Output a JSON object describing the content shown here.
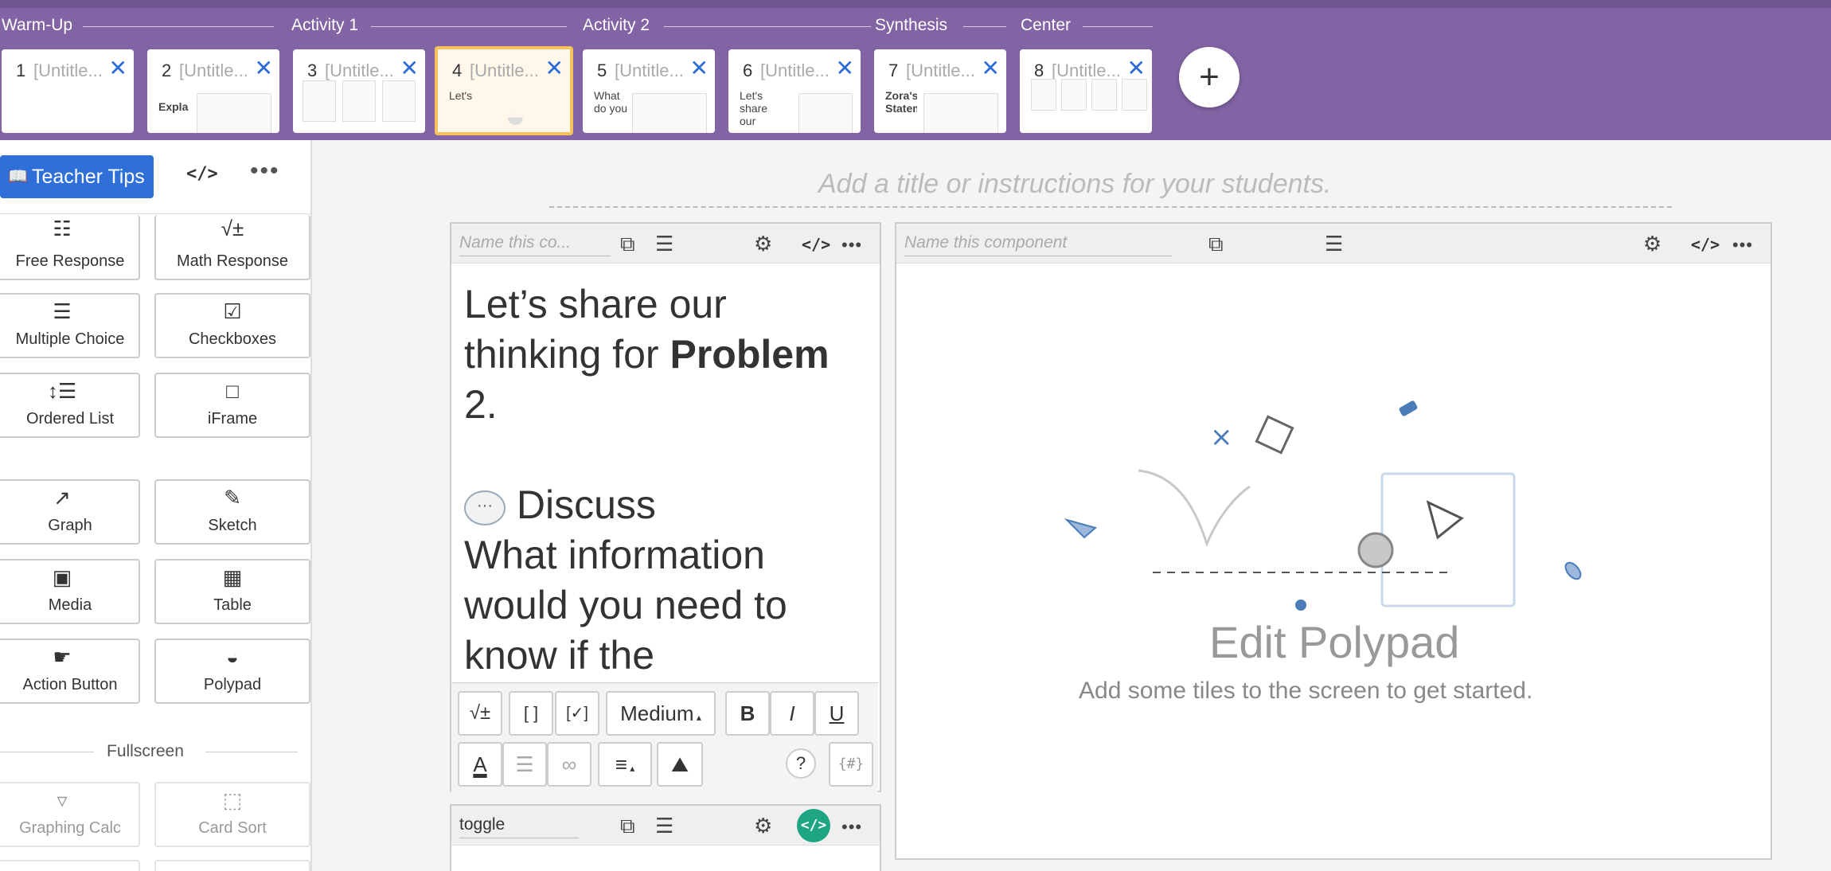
{
  "sections": [
    {
      "label": "Warm-Up"
    },
    {
      "label": "Activity 1"
    },
    {
      "label": "Activity 2"
    },
    {
      "label": "Synthesis"
    },
    {
      "label": "Center"
    }
  ],
  "screens": [
    {
      "num": "1",
      "title": "[Untitle...",
      "snippet": ""
    },
    {
      "num": "2",
      "title": "[Untitle...",
      "snippet": "Expla"
    },
    {
      "num": "3",
      "title": "[Untitle...",
      "snippet": ""
    },
    {
      "num": "4",
      "title": "[Untitle...",
      "snippet": "Let's"
    },
    {
      "num": "5",
      "title": "[Untitle...",
      "snippet": "What do you"
    },
    {
      "num": "6",
      "title": "[Untitle...",
      "snippet": "Let's share our"
    },
    {
      "num": "7",
      "title": "[Untitle...",
      "snippet": "Zora's Statement"
    },
    {
      "num": "8",
      "title": "[Untitle...",
      "snippet": ""
    }
  ],
  "add_screen_label": "+",
  "left_panel": {
    "teacher_tips": "Teacher Tips",
    "code_label": "</>",
    "more_label": "•••",
    "tiles": [
      {
        "label": "Free Response",
        "icon": "☷"
      },
      {
        "label": "Math Response",
        "icon": "√±"
      },
      {
        "label": "Multiple Choice",
        "icon": "☰"
      },
      {
        "label": "Checkboxes",
        "icon": "☑"
      },
      {
        "label": "Ordered List",
        "icon": "↕☰"
      },
      {
        "label": "iFrame",
        "icon": "□"
      },
      {
        "label": "Graph",
        "icon": "↗"
      },
      {
        "label": "Sketch",
        "icon": "✎"
      },
      {
        "label": "Media",
        "icon": "▣"
      },
      {
        "label": "Table",
        "icon": "▦"
      },
      {
        "label": "Action Button",
        "icon": "☛"
      },
      {
        "label": "Polypad",
        "icon": "◒"
      }
    ],
    "fullscreen_label": "Fullscreen",
    "fullscreen_tiles": [
      {
        "label": "Graphing Calc",
        "icon": "▿"
      },
      {
        "label": "Card Sort",
        "icon": "⬚"
      }
    ]
  },
  "main": {
    "instructions_placeholder": "Add a title or instructions for your students.",
    "text_component": {
      "name_placeholder": "Name this co...",
      "line1": "Let’s share our",
      "line2_a": "thinking for ",
      "line2_b": "Problem",
      "line3": "2.",
      "discuss_heading": "Discuss",
      "body1": "What information",
      "body2": "would you need to",
      "body3": "know if the"
    },
    "toolbar": {
      "math": "√±",
      "brackets": "[ ]",
      "blank": "[✓]",
      "size": "Medium",
      "bold": "B",
      "italic": "I",
      "underline": "U",
      "color": "A",
      "list": "☰",
      "link": "∞",
      "align": "≡",
      "image": "⛰",
      "help": "?",
      "variable": "{#}"
    },
    "toggle_component": {
      "name_value": "toggle"
    },
    "polypad_component": {
      "name_placeholder": "Name this component",
      "title": "Edit Polypad",
      "subtitle": "Add some tiles to the screen to get started."
    }
  },
  "colors": {
    "header": "#8264a4",
    "accent": "#2e6fd8",
    "active_card": "#f7c15c",
    "code_green": "#1ea584"
  }
}
